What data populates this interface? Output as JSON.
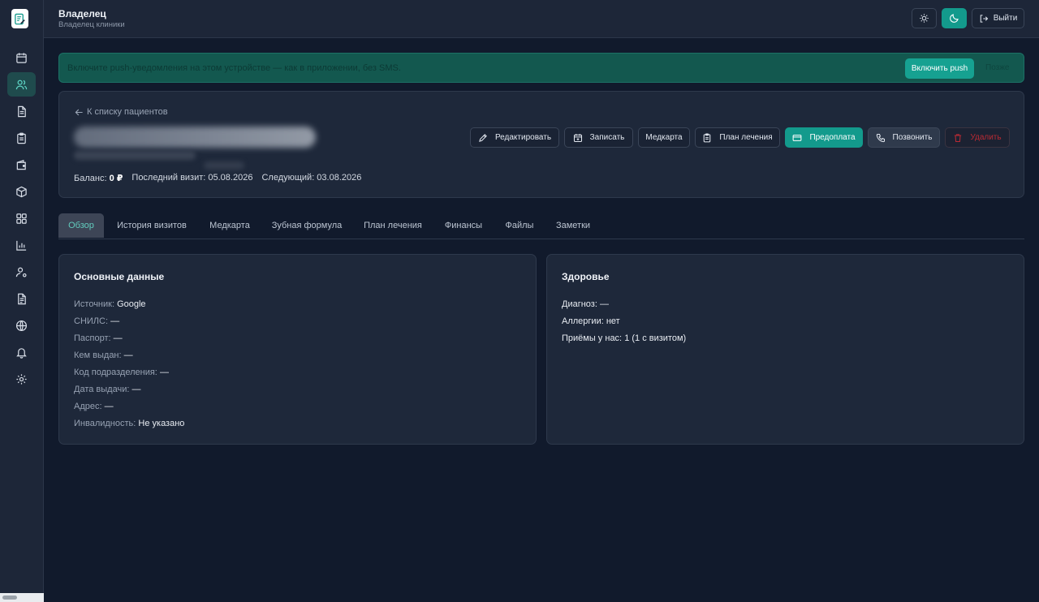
{
  "header": {
    "title": "Владелец",
    "subtitle": "Владелец клиники",
    "logout_label": "Выйти"
  },
  "sidebar": {
    "items": [
      {
        "icon": "calendar-icon"
      },
      {
        "icon": "users-icon",
        "active": true
      },
      {
        "icon": "document-icon"
      },
      {
        "icon": "clipboard-icon"
      },
      {
        "icon": "wallet-icon"
      },
      {
        "icon": "box-icon"
      },
      {
        "icon": "grid-icon"
      },
      {
        "icon": "chart-icon"
      },
      {
        "icon": "user-settings-icon"
      },
      {
        "icon": "file-text-icon"
      },
      {
        "icon": "globe-icon"
      },
      {
        "icon": "bell-icon"
      },
      {
        "icon": "gear-icon"
      }
    ]
  },
  "banner": {
    "text": "Включите push-уведомления на этом устройстве — как в приложении, без SMS.",
    "enable_label": "Включить push",
    "later_label": "Позже"
  },
  "patient": {
    "back_label": "К списку пациентов",
    "balance_label": "Баланс:",
    "balance_value": "0 ₽",
    "last_visit": "Последний визит: 05.08.2026",
    "next_visit": "Следующий: 03.08.2026",
    "actions": {
      "edit": "Редактировать",
      "book": "Записать",
      "medcard": "Медкарта",
      "plan": "План лечения",
      "prepay": "Предоплата",
      "call": "Позвонить",
      "delete": "Удалить"
    }
  },
  "tabs": [
    "Обзор",
    "История визитов",
    "Медкарта",
    "Зубная формула",
    "План лечения",
    "Финансы",
    "Файлы",
    "Заметки"
  ],
  "basic": {
    "title": "Основные данные",
    "rows": [
      {
        "label": "Источник:",
        "value": "Google"
      },
      {
        "label": "СНИЛС:",
        "value": "—"
      },
      {
        "label": "Паспорт:",
        "value": "—"
      },
      {
        "label": "Кем выдан:",
        "value": "—"
      },
      {
        "label": "Код подразделения:",
        "value": "—"
      },
      {
        "label": "Дата выдачи:",
        "value": "—"
      },
      {
        "label": "Адрес:",
        "value": "—"
      },
      {
        "label": "Инвалидность:",
        "value": "Не указано"
      }
    ]
  },
  "health": {
    "title": "Здоровье",
    "rows": [
      {
        "label": "Диагноз:",
        "value": "—"
      },
      {
        "label": "Аллергии:",
        "value": "нет"
      },
      {
        "label": "Приёмы у нас:",
        "value": "1 (1 с визитом)"
      }
    ]
  }
}
